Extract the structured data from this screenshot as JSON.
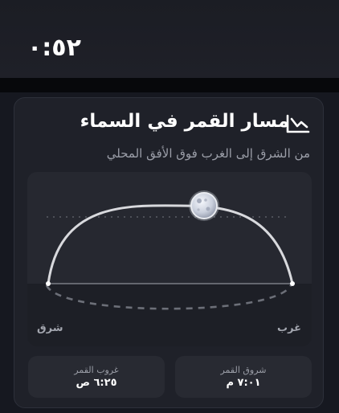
{
  "status": {
    "time": "٠:٥٢"
  },
  "card": {
    "title": "مسار القمر في السماء",
    "subtitle": "من الشرق إلى الغرب فوق الأفق المحلي",
    "icon": "chart-icon",
    "east_label": "شرق",
    "west_label": "غرب",
    "moon_icon": "moon-icon"
  },
  "info": {
    "moonrise": {
      "label": "شروق القمر",
      "value": "٧:٠١ م"
    },
    "moonset": {
      "label": "غروب القمر",
      "value": "٦:٢٥ ص"
    }
  },
  "colors": {
    "accent": "#ffffff",
    "card_bg": "#1f2129",
    "muted_text": "#9b9ea8"
  }
}
